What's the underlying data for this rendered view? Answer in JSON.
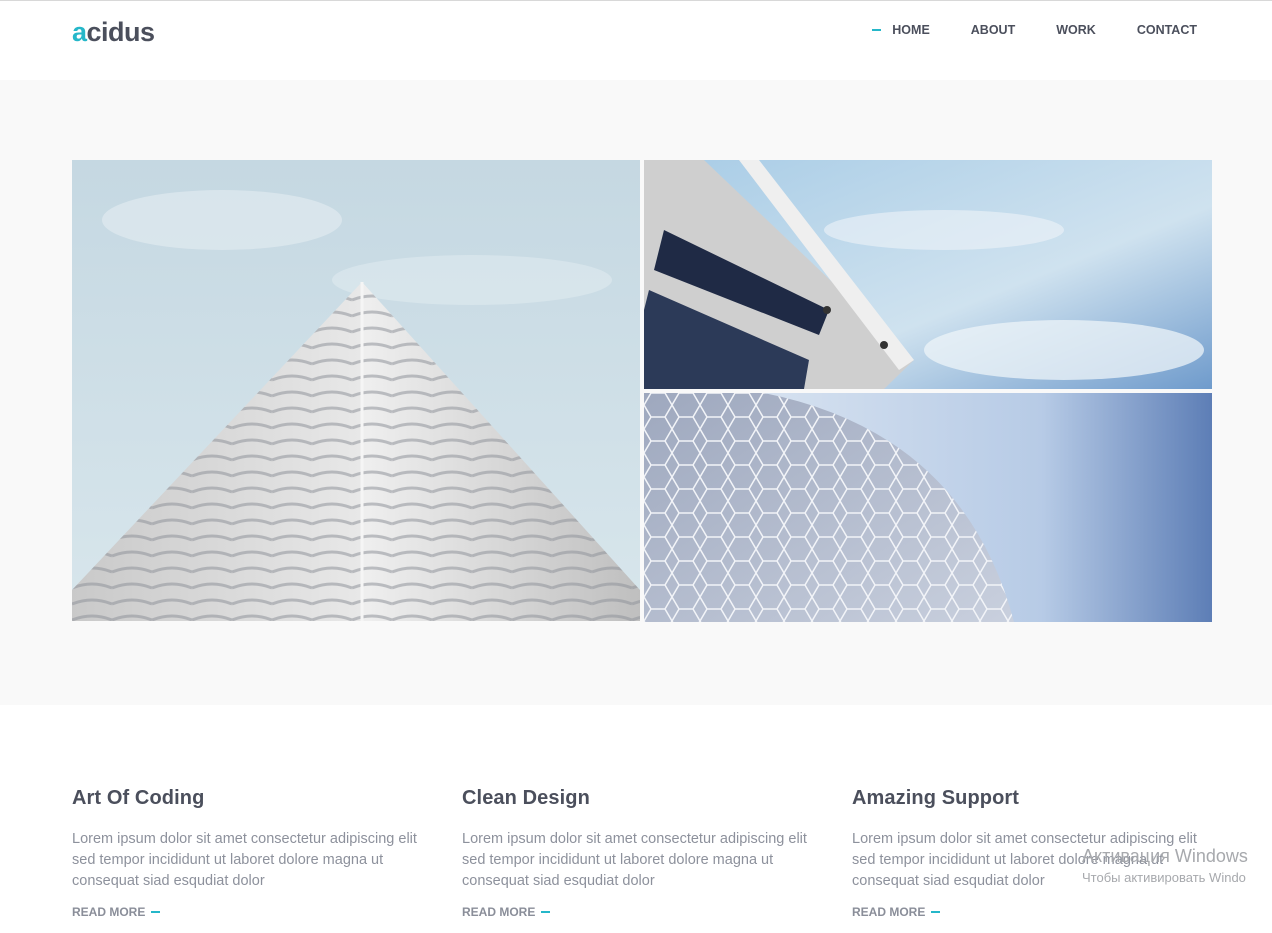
{
  "header": {
    "logo_accent": "a",
    "logo_rest": "cidus",
    "nav": [
      {
        "label": "HOME",
        "active": true
      },
      {
        "label": "ABOUT"
      },
      {
        "label": "WORK"
      },
      {
        "label": "CONTACT"
      }
    ]
  },
  "hero": {
    "images": [
      {
        "name": "pyramid-building-photo"
      },
      {
        "name": "curved-facade-photo"
      },
      {
        "name": "hexagon-dome-photo"
      }
    ]
  },
  "features": [
    {
      "title": "Art Of Coding",
      "text": "Lorem ipsum dolor sit amet consectetur adipiscing elit sed tempor incididunt ut laboret dolore magna ut consequat siad esqudiat dolor",
      "link": "READ MORE"
    },
    {
      "title": "Clean Design",
      "text": "Lorem ipsum dolor sit amet consectetur adipiscing elit sed tempor incididunt ut laboret dolore magna ut consequat siad esqudiat dolor",
      "link": "READ MORE"
    },
    {
      "title": "Amazing Support",
      "text": "Lorem ipsum dolor sit amet consectetur adipiscing elit sed tempor incididunt ut laboret dolore magna ut consequat siad esqudiat dolor",
      "link": "READ MORE"
    }
  ],
  "watermark": {
    "title": "Активация Windows",
    "subtitle": "Чтобы активировать Windo"
  },
  "colors": {
    "accent": "#25b7c9",
    "text_dark": "#4b4f5c",
    "text_muted": "#8d919c",
    "hero_bg": "#f9f9f9"
  }
}
